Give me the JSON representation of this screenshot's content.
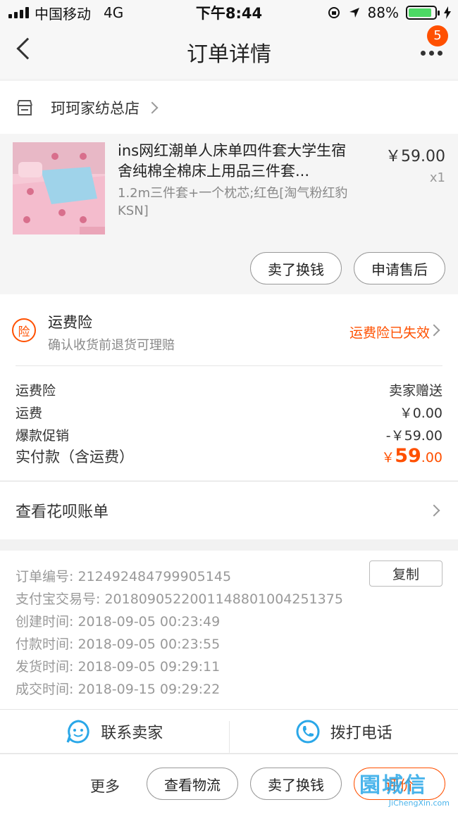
{
  "status_bar": {
    "carrier": "中国移动",
    "network": "4G",
    "time": "下午8:44",
    "battery": "88%",
    "battery_level": 0.88
  },
  "nav": {
    "title": "订单详情",
    "badge_count": "5"
  },
  "shop": {
    "name": "珂珂家纺总店"
  },
  "product": {
    "title": "ins网红潮单人床单四件套大学生宿舍纯棉全棉床上用品三件套...",
    "sku": "1.2m三件套+一个枕芯;红色[淘气粉红豹 KSN]",
    "price": "￥59.00",
    "quantity": "x1",
    "buttons": {
      "sell": "卖了换钱",
      "after_sale": "申请售后"
    }
  },
  "insurance": {
    "icon_text": "险",
    "title": "运费险",
    "subtitle": "确认收货前退货可理赔",
    "status": "运费险已失效"
  },
  "fees": [
    {
      "label": "运费险",
      "value": "卖家赠送"
    },
    {
      "label": "运费",
      "value": "￥0.00"
    },
    {
      "label": "爆款促销",
      "value": "-￥59.00"
    }
  ],
  "total": {
    "label": "实付款（含运费）",
    "currency": "￥",
    "integer": "59",
    "decimal": ".00"
  },
  "huabei": {
    "label": "查看花呗账单"
  },
  "order_info": {
    "order_no": "订单编号:  212492484799905145",
    "alipay_no": "支付宝交易号:  2018090522001148801004251375",
    "created": "创建时间:  2018-09-05 00:23:49",
    "paid": "付款时间:  2018-09-05 00:23:55",
    "shipped": "发货时间:  2018-09-05 09:29:11",
    "completed": "成交时间:  2018-09-15 09:29:22",
    "copy_label": "复制"
  },
  "contact": {
    "seller": "联系卖家",
    "phone": "拨打电话"
  },
  "bottom_bar": {
    "more": "更多",
    "logistics": "查看物流",
    "sell": "卖了换钱",
    "rate": "评价"
  },
  "watermark": {
    "main": "園城信",
    "sub": "JiChengXin.com"
  },
  "colors": {
    "accent": "#ff5000",
    "link_blue": "#2aa7e8"
  }
}
